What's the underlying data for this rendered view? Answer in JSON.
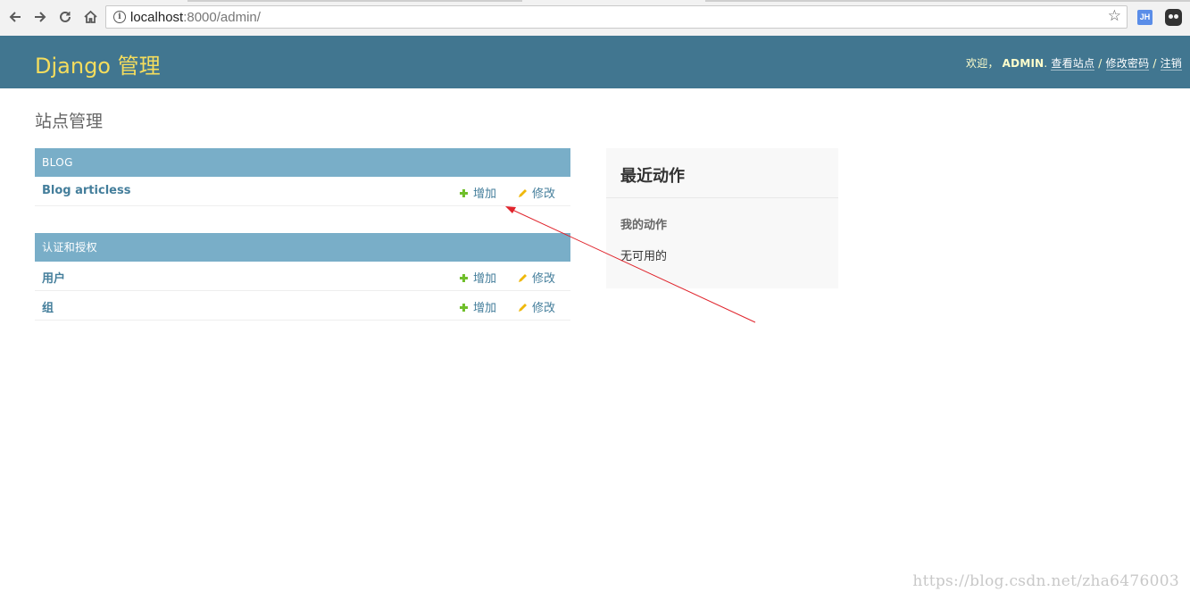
{
  "browser": {
    "url_host": "localhost",
    "url_rest": ":8000/admin/",
    "icons": [
      "back-icon",
      "forward-icon",
      "reload-icon",
      "home-icon",
      "info-icon",
      "star-icon",
      "jh-extension-icon",
      "ghost-extension-icon"
    ],
    "jh_label": "JH"
  },
  "header": {
    "brand": "Django 管理",
    "welcome": "欢迎，",
    "username": "ADMIN",
    "sep1": ".",
    "view_site": "查看站点",
    "sep2": " / ",
    "change_password": "修改密码",
    "sep3": " / ",
    "logout": "注销",
    "brand_color": "#f5dd5d",
    "bar_color": "#417690"
  },
  "content": {
    "title": "站点管理",
    "modules": [
      {
        "caption": "BLOG",
        "models": [
          {
            "name": "Blog articless",
            "add": "增加",
            "change": "修改"
          }
        ]
      },
      {
        "caption": "认证和授权",
        "models": [
          {
            "name": "用户",
            "add": "增加",
            "change": "修改"
          },
          {
            "name": "组",
            "add": "增加",
            "change": "修改"
          }
        ]
      }
    ]
  },
  "recent_actions": {
    "title": "最近动作",
    "subtitle": "我的动作",
    "empty": "无可用的"
  },
  "watermark": "https://blog.csdn.net/zha6476003",
  "colors": {
    "caption_bg": "#79aec8",
    "link": "#447e9b",
    "add_icon": "#70bf2b",
    "change_icon": "#efb80b",
    "annotation_arrow": "#e0242c"
  }
}
